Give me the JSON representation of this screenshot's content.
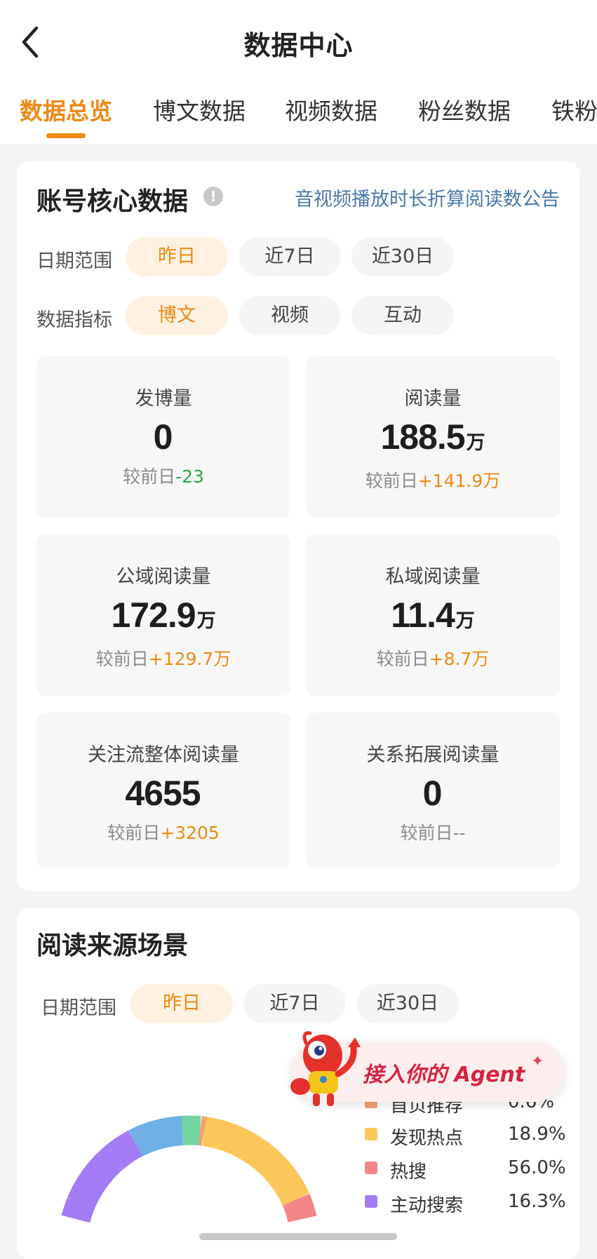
{
  "header": {
    "title": "数据中心",
    "back_icon": "chevron-left-icon"
  },
  "tabs": [
    {
      "label": "数据总览",
      "active": true
    },
    {
      "label": "博文数据",
      "active": false
    },
    {
      "label": "视频数据",
      "active": false
    },
    {
      "label": "粉丝数据",
      "active": false
    },
    {
      "label": "铁粉",
      "active": false
    }
  ],
  "core": {
    "title": "账号核心数据",
    "info_icon": "info-icon",
    "notice_link": "音视频播放时长折算阅读数公告",
    "date_label": "日期范围",
    "date_options": [
      "昨日",
      "近7日",
      "近30日"
    ],
    "metric_label": "数据指标",
    "metric_options": [
      "博文",
      "视频",
      "互动"
    ],
    "compare_prefix": "较前日",
    "stats": [
      {
        "label": "发博量",
        "value": "0",
        "unit": "",
        "delta": "-23",
        "trend": "down"
      },
      {
        "label": "阅读量",
        "value": "188.5",
        "unit": "万",
        "delta": "+141.9万",
        "trend": "up"
      },
      {
        "label": "公域阅读量",
        "value": "172.9",
        "unit": "万",
        "delta": "+129.7万",
        "trend": "up"
      },
      {
        "label": "私域阅读量",
        "value": "11.4",
        "unit": "万",
        "delta": "+8.7万",
        "trend": "up"
      },
      {
        "label": "关注流整体阅读量",
        "value": "4655",
        "unit": "",
        "delta": "+3205",
        "trend": "up"
      },
      {
        "label": "关系拓展阅读量",
        "value": "0",
        "unit": "",
        "delta": "--",
        "trend": "none"
      }
    ]
  },
  "source": {
    "title": "阅读来源场景",
    "date_label": "日期范围",
    "date_options": [
      "昨日",
      "近7日",
      "近30日"
    ],
    "legend": [
      {
        "label": "首页推荐",
        "pct": "0.6%",
        "color": "#f0a070"
      },
      {
        "label": "发现热点",
        "pct": "18.9%",
        "color": "#fcc75a"
      },
      {
        "label": "热搜",
        "pct": "56.0%",
        "color": "#f38787"
      },
      {
        "label": "主动搜索",
        "pct": "16.3%",
        "color": "#a37cf5"
      }
    ],
    "donut_extra_colors": [
      "#6fb0e6",
      "#72d3a3"
    ]
  },
  "agent_banner": {
    "text": "接入你的 Agent",
    "star_icon": "sparkle-icon",
    "mascot_icon": "lobster-mascot-icon"
  },
  "colors": {
    "accent": "#ee8a13",
    "accent_bg": "#fef1e2",
    "up": "#ee8a13",
    "down": "#2aa847",
    "link": "#4a78a8"
  }
}
